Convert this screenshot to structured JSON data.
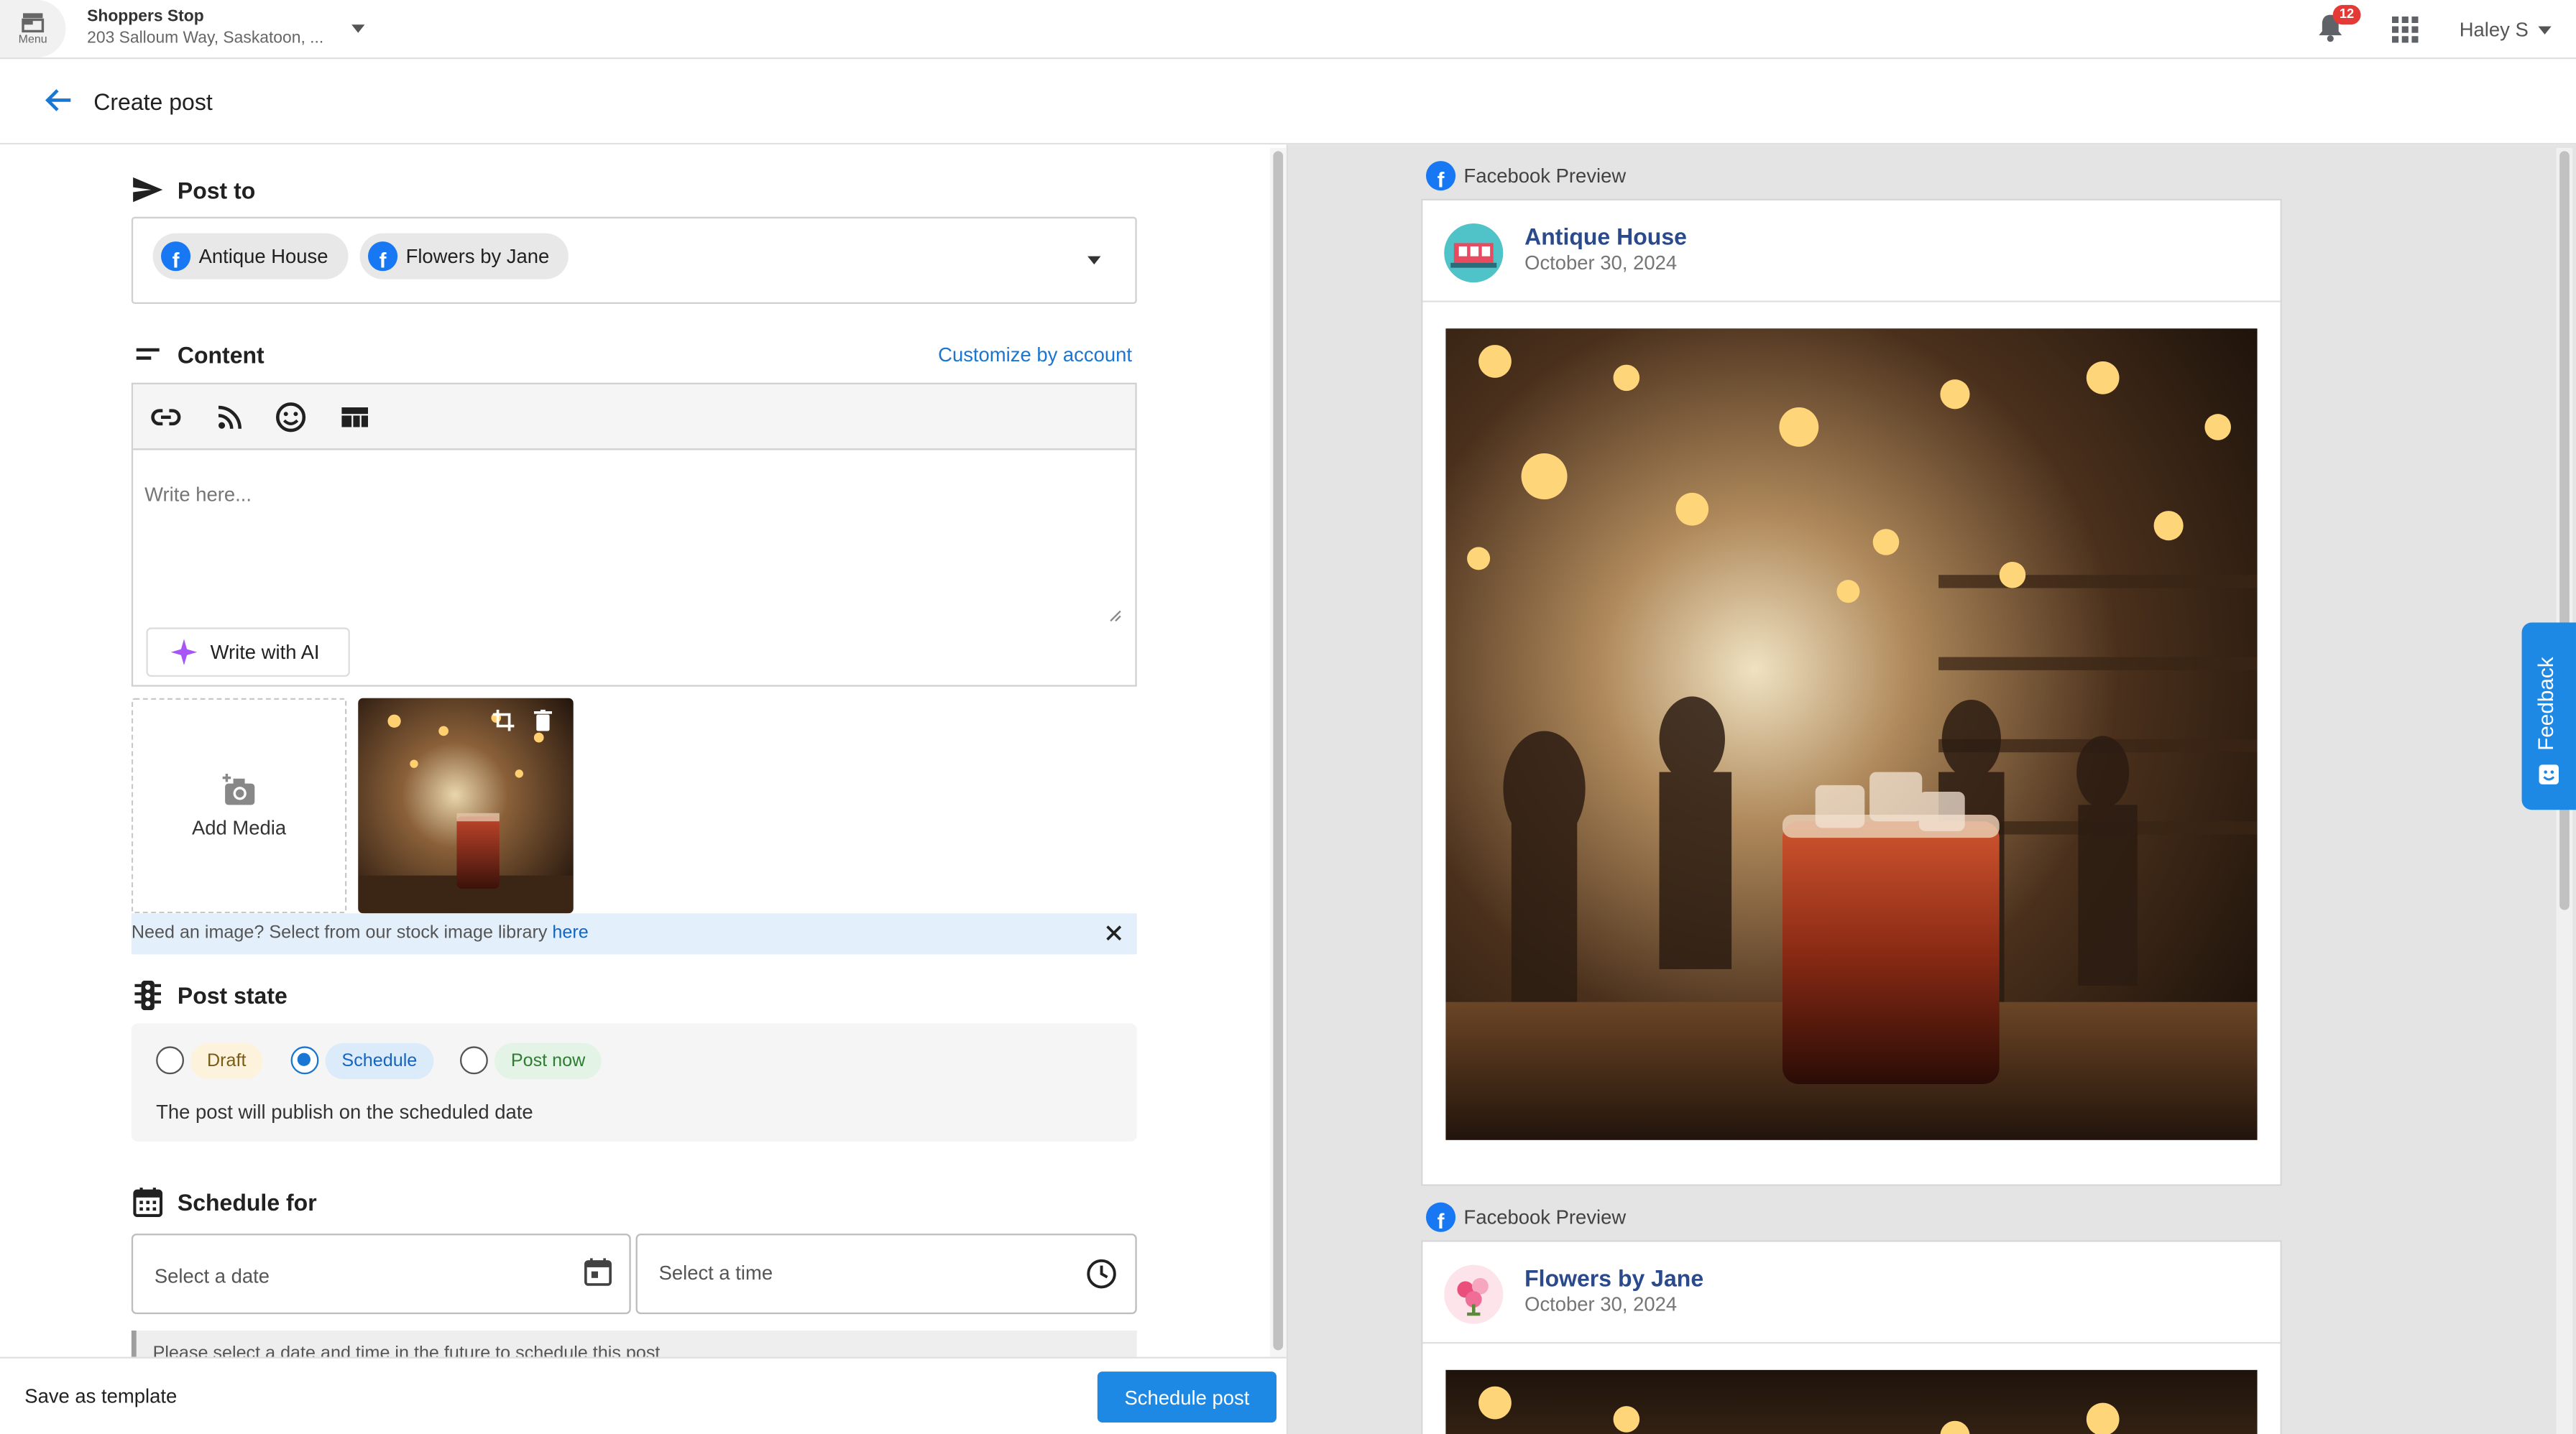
{
  "topbar": {
    "menu_label": "Menu",
    "store_name": "Shoppers Stop",
    "store_address": "203 Salloum Way, Saskatoon, ...",
    "notification_count": "12",
    "user_name": "Haley S"
  },
  "page": {
    "title": "Create post"
  },
  "post_to": {
    "heading": "Post to",
    "accounts": [
      {
        "label": "Antique House"
      },
      {
        "label": "Flowers by Jane"
      }
    ]
  },
  "content": {
    "heading": "Content",
    "customize_link": "Customize by account",
    "placeholder": "Write here...",
    "ai_button": "Write with AI",
    "toolbar_icons": [
      "link-icon",
      "rss-icon",
      "emoji-icon",
      "template-icon"
    ]
  },
  "media": {
    "add_label": "Add Media",
    "stock_text": "Need an image? Select from our stock image library ",
    "stock_link": "here"
  },
  "post_state": {
    "heading": "Post state",
    "options": [
      {
        "label": "Draft",
        "selected": false
      },
      {
        "label": "Schedule",
        "selected": true
      },
      {
        "label": "Post now",
        "selected": false
      }
    ],
    "note": "The post will publish on the scheduled date"
  },
  "schedule": {
    "heading": "Schedule for",
    "date_placeholder": "Select a date",
    "time_placeholder": "Select a time",
    "warning": "Please select a date and time in the future to schedule this post"
  },
  "footer": {
    "save_template": "Save as template",
    "schedule_button": "Schedule post"
  },
  "previews": [
    {
      "label": "Facebook Preview",
      "account": "Antique House",
      "date": "October 30, 2024"
    },
    {
      "label": "Facebook Preview",
      "account": "Flowers by Jane",
      "date": "October 30, 2024"
    }
  ],
  "feedback": {
    "label": "Feedback"
  },
  "colors": {
    "accent": "#1e88e5",
    "facebook": "#1877f2",
    "account_name": "#2b4a8b"
  }
}
